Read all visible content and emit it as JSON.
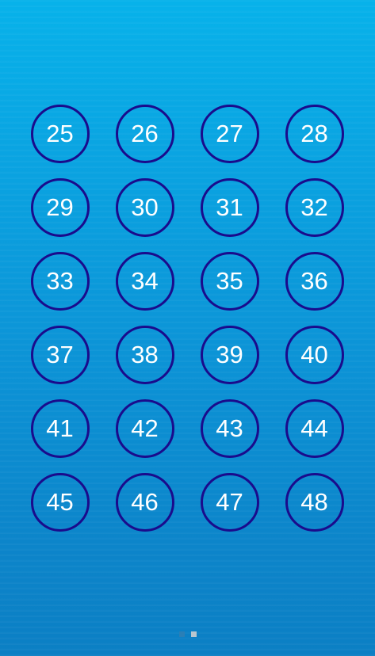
{
  "levels": [
    "25",
    "26",
    "27",
    "28",
    "29",
    "30",
    "31",
    "32",
    "33",
    "34",
    "35",
    "36",
    "37",
    "38",
    "39",
    "40",
    "41",
    "42",
    "43",
    "44",
    "45",
    "46",
    "47",
    "48"
  ],
  "pages": [
    {
      "active": false,
      "color": "#2a7fb6"
    },
    {
      "active": true,
      "color": "#b9c6cf"
    }
  ],
  "colors": {
    "circle_border": "#1a0b8c",
    "number_text": "#ffffff",
    "background_top": "#07b2ea",
    "background_bottom": "#0b7fc4"
  }
}
